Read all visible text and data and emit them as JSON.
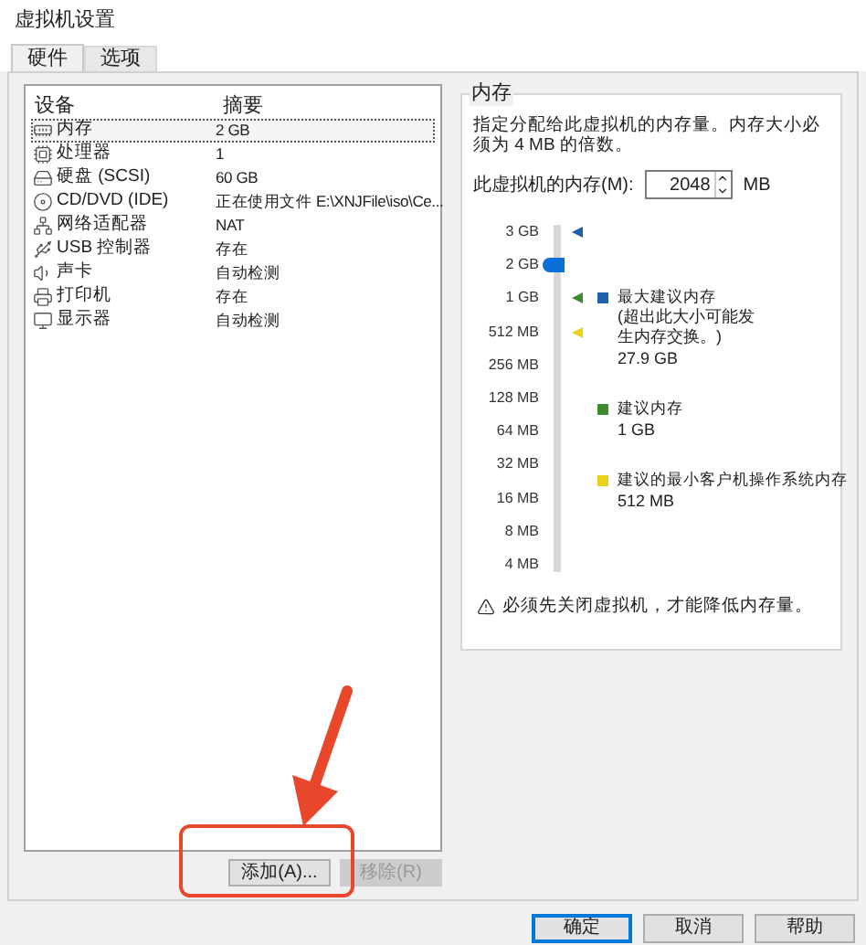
{
  "window": {
    "title": "虚拟机设置"
  },
  "tabs": [
    {
      "label": "硬件",
      "selected": true
    },
    {
      "label": "选项",
      "selected": false
    }
  ],
  "devices": {
    "columns": [
      "设备",
      "摘要"
    ],
    "rows": [
      {
        "kind": "memory",
        "name": "内存",
        "summary": "2 GB",
        "selected": true
      },
      {
        "kind": "cpu",
        "name": "处理器",
        "summary": "1",
        "selected": false
      },
      {
        "kind": "disk",
        "name": "硬盘 (SCSI)",
        "summary": "60 GB",
        "selected": false
      },
      {
        "kind": "cd",
        "name": "CD/DVD (IDE)",
        "summary": "正在使用文件 E:\\XNJFile\\iso\\Ce...",
        "selected": false
      },
      {
        "kind": "network",
        "name": "网络适配器",
        "summary": "NAT",
        "selected": false
      },
      {
        "kind": "usb",
        "name": "USB 控制器",
        "summary": "存在",
        "selected": false
      },
      {
        "kind": "sound",
        "name": "声卡",
        "summary": "自动检测",
        "selected": false
      },
      {
        "kind": "printer",
        "name": "打印机",
        "summary": "存在",
        "selected": false
      },
      {
        "kind": "display",
        "name": "显示器",
        "summary": "自动检测",
        "selected": false
      }
    ],
    "buttons": [
      {
        "label": "添加(A)...",
        "disabled": false
      },
      {
        "label": "移除(R)",
        "disabled": true
      }
    ]
  },
  "memory": {
    "title": "内存",
    "description": "指定分配给此虚拟机的内存量。内存大小必须为 4 MB 的倍数。",
    "field_label": "此虚拟机的内存(M):",
    "value": "2048",
    "unit": "MB",
    "slider": {
      "level": 0.9,
      "ticks": [
        {
          "label": "3 GB",
          "color": "#1f5fae"
        },
        {
          "label": "2 GB"
        },
        {
          "label": "1 GB",
          "color": "#3c8a2e"
        },
        {
          "label": "512 MB",
          "color": "#e8d21c"
        },
        {
          "label": "256 MB"
        },
        {
          "label": "128 MB"
        },
        {
          "label": "64 MB"
        },
        {
          "label": "32 MB"
        },
        {
          "label": "16 MB"
        },
        {
          "label": "8 MB"
        },
        {
          "label": "4 MB"
        }
      ]
    },
    "legend": [
      {
        "label": "最大建议内存",
        "note": "(超出此大小可能发生内存交换。)",
        "value": "27.9 GB",
        "color": "#1f5fae"
      },
      {
        "label": "建议内存",
        "value": "1 GB",
        "color": "#3c8a2e"
      },
      {
        "label": "建议的最小客户机操作系统内存",
        "value": "512 MB",
        "color": "#e8d21c"
      }
    ],
    "warning": "必须先关闭虚拟机，才能降低内存量。"
  },
  "footer_buttons": [
    {
      "label": "确定",
      "selected": true
    },
    {
      "label": "取消",
      "selected": false
    },
    {
      "label": "帮助",
      "selected": false
    }
  ]
}
